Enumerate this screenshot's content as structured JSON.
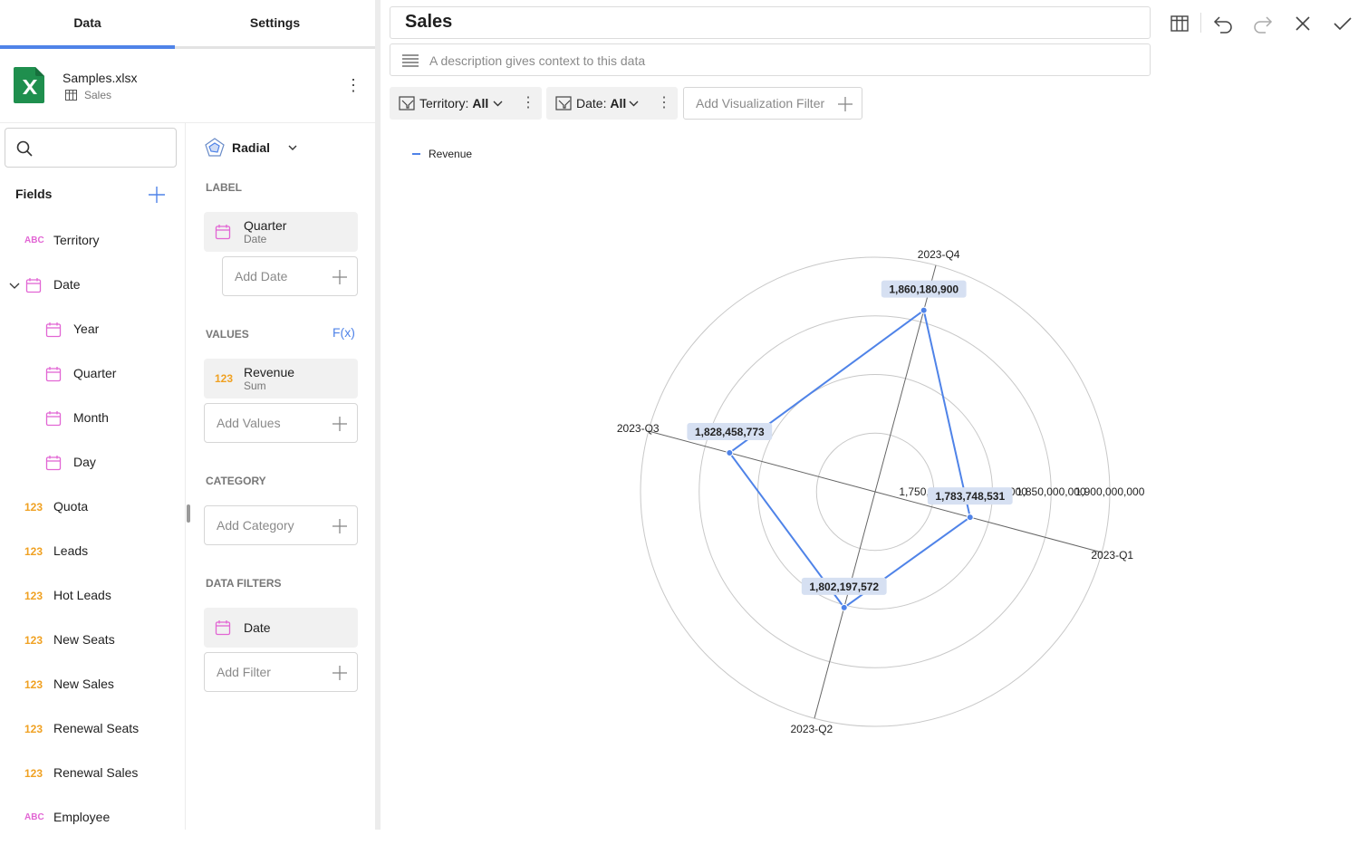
{
  "left": {
    "tabs": [
      "Data",
      "Settings"
    ],
    "source": {
      "file": "Samples.xlsx",
      "sheet": "Sales"
    },
    "search": {
      "placeholder": ""
    },
    "fields_title": "Fields",
    "fields": [
      {
        "label": "Territory",
        "type": "ABC"
      },
      {
        "label": "Date",
        "type": "date",
        "expanded": true
      },
      {
        "label": "Year",
        "type": "date"
      },
      {
        "label": "Quarter",
        "type": "date"
      },
      {
        "label": "Month",
        "type": "date"
      },
      {
        "label": "Day",
        "type": "date"
      },
      {
        "label": "Quota",
        "type": "123"
      },
      {
        "label": "Leads",
        "type": "123"
      },
      {
        "label": "Hot Leads",
        "type": "123"
      },
      {
        "label": "New Seats",
        "type": "123"
      },
      {
        "label": "New Sales",
        "type": "123"
      },
      {
        "label": "Renewal Seats",
        "type": "123"
      },
      {
        "label": "Renewal Sales",
        "type": "123"
      },
      {
        "label": "Employee",
        "type": "ABC"
      }
    ]
  },
  "config": {
    "viz_type": "Radial",
    "label_section": "LABEL",
    "label_field": {
      "name": "Quarter",
      "sub": "Date"
    },
    "add_date": "Add Date",
    "values_section": "VALUES",
    "fx": "F(x)",
    "value_field": {
      "name": "Revenue",
      "sub": "Sum",
      "type": "123"
    },
    "add_values": "Add Values",
    "category_section": "CATEGORY",
    "add_category": "Add Category",
    "filters_section": "DATA FILTERS",
    "filter_field": "Date",
    "add_filter": "Add Filter"
  },
  "main": {
    "title": "Sales",
    "description_placeholder": "A description gives context to this data",
    "filters": [
      {
        "label": "Territory:",
        "value": "All"
      },
      {
        "label": "Date:",
        "value": "All"
      }
    ],
    "add_viz_filter": "Add Visualization Filter"
  },
  "colors": {
    "accent": "#4f83e8",
    "number": "#f0a122",
    "text_type": "#e266d4"
  },
  "chart_data": {
    "type": "radial",
    "legend": "Revenue",
    "legend_position": "top-left",
    "categories": [
      "2023-Q1",
      "2023-Q2",
      "2023-Q3",
      "2023-Q4"
    ],
    "series": [
      {
        "name": "Revenue",
        "values": [
          1783748531,
          1802197572,
          1828458773,
          1860180900
        ],
        "value_labels": [
          "1,783,748,531",
          "1,802,197,572",
          "1,828,458,773",
          "1,860,180,900"
        ]
      }
    ],
    "radial_axis": {
      "range": [
        1700000000,
        1900000000
      ],
      "ticks": [
        1750000000,
        1800000000,
        1850000000,
        1900000000
      ],
      "tick_labels": [
        "1,750,000,000",
        "1,800,000,000",
        "1,850,000,000",
        "1,900,000,000"
      ]
    },
    "grid": true
  }
}
